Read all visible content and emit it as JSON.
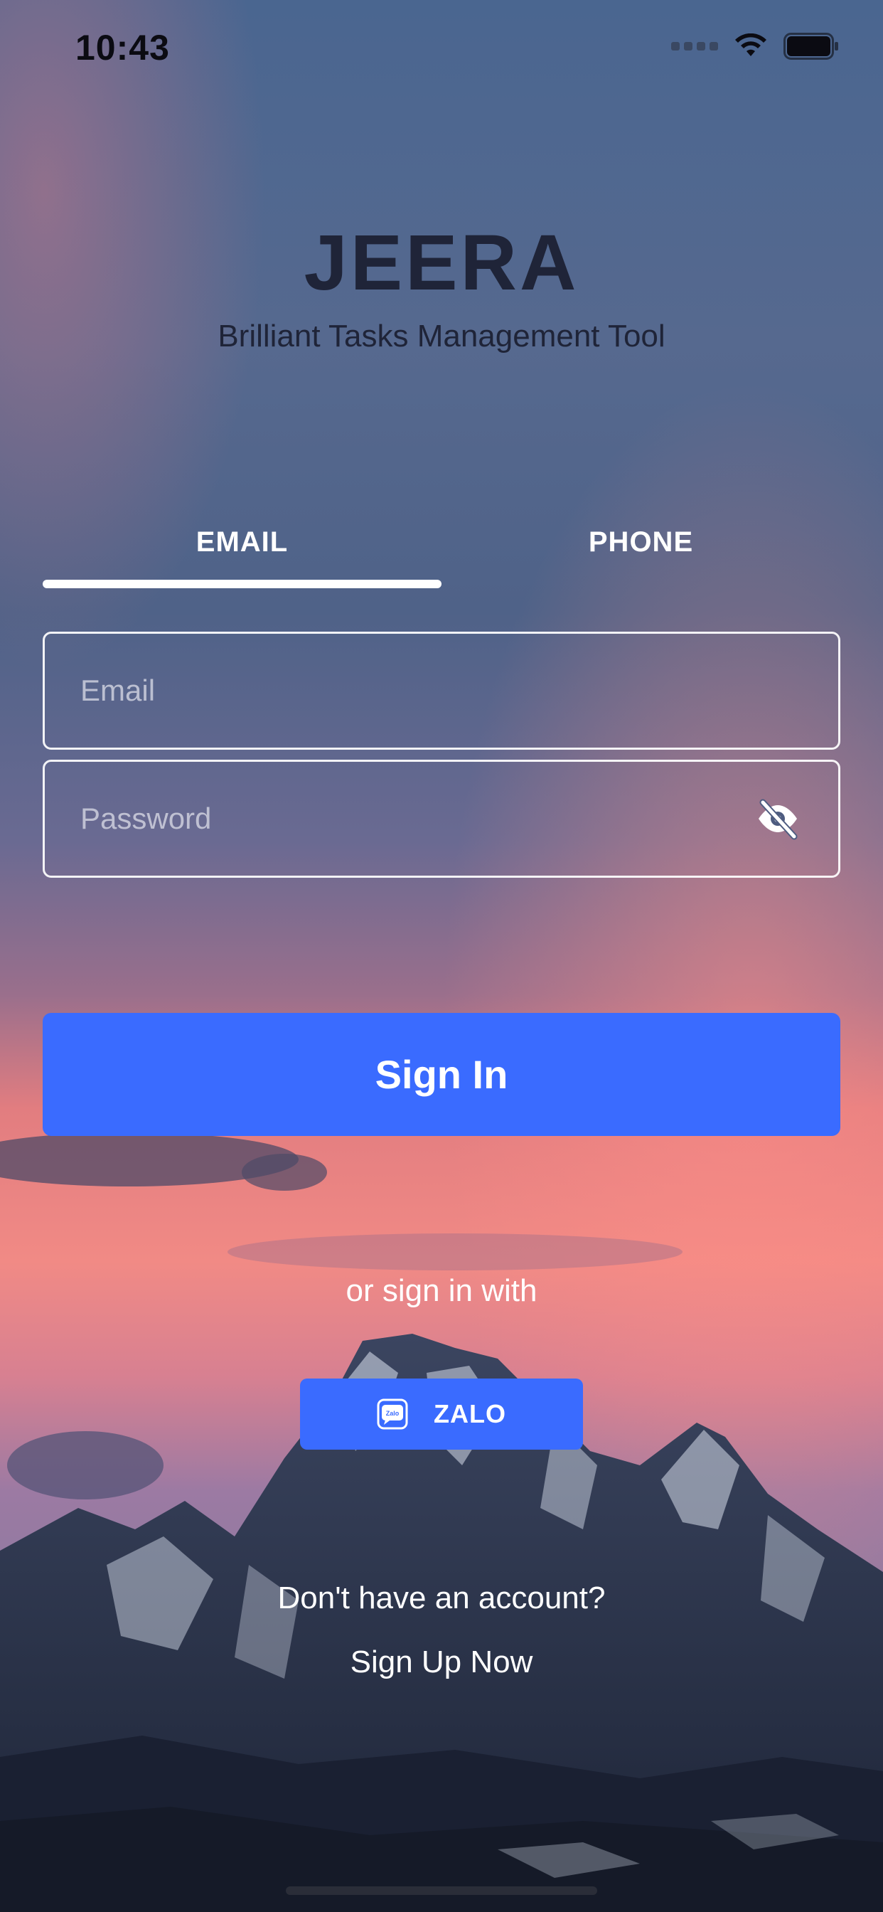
{
  "status_bar": {
    "time": "10:43",
    "icons": [
      "signal-dots-icon",
      "wifi-icon",
      "battery-icon"
    ]
  },
  "header": {
    "title": "JEERA",
    "subtitle": "Brilliant Tasks Management Tool"
  },
  "tabs": [
    {
      "label": "EMAIL",
      "active": true
    },
    {
      "label": "PHONE",
      "active": false
    }
  ],
  "form": {
    "email": {
      "value": "",
      "placeholder": "Email"
    },
    "password": {
      "value": "",
      "placeholder": "Password",
      "toggle_icon": "eye-slash-icon"
    }
  },
  "signin_label": "Sign In",
  "alt_signin": {
    "text": "or sign in with",
    "zalo_label": "ZALO",
    "zalo_icon": "zalo-icon"
  },
  "signup": {
    "prompt": "Don't have an account?",
    "link": "Sign Up Now"
  },
  "colors": {
    "accent": "#3a6bff",
    "title": "#1f2438",
    "text_light": "#ffffff"
  }
}
